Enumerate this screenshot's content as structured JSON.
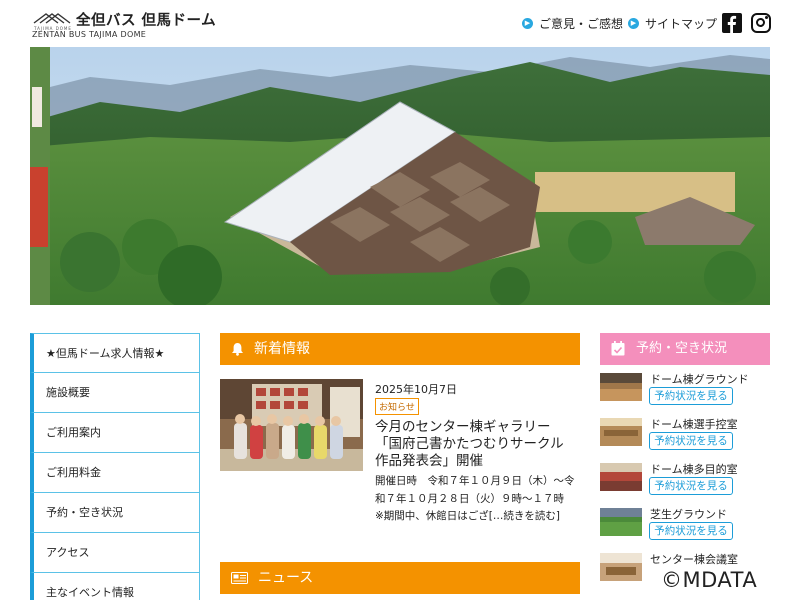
{
  "header": {
    "logo_small": "TAJIMA DOME",
    "logo_jp": "全但バス 但馬ドーム",
    "logo_en": "ZENTAN BUS TAJIMA DOME",
    "links": [
      {
        "label": "ご意見・ご感想"
      },
      {
        "label": "サイトマップ"
      }
    ]
  },
  "sidebar": {
    "items": [
      {
        "label": "★但馬ドーム求人情報★"
      },
      {
        "label": "施設概要"
      },
      {
        "label": "ご利用案内"
      },
      {
        "label": "ご利用料金"
      },
      {
        "label": "予約・空き状況"
      },
      {
        "label": "アクセス"
      },
      {
        "label": "主なイベント情報"
      }
    ]
  },
  "news": {
    "heading": "新着情報",
    "date": "2025年10月7日",
    "tag": "お知らせ",
    "title": "今月のセンター棟ギャラリー「国府己書かたつむりサークル作品発表会」開催",
    "body": "開催日時　令和７年１０月９日（木）～令和７年１０月２８日（火）９時～１７時　　※期間中、休館日はござ[…続きを読む]"
  },
  "news2": {
    "heading": "ニュース"
  },
  "reservation": {
    "heading": "予約・空き状況",
    "button_label": "予約状況を見る",
    "items": [
      {
        "name": "ドーム棟グラウンド"
      },
      {
        "name": "ドーム棟選手控室"
      },
      {
        "name": "ドーム棟多目的室"
      },
      {
        "name": "芝生グラウンド"
      },
      {
        "name": "センター棟会議室"
      }
    ]
  },
  "watermark": "©MDATA",
  "colors": {
    "accent_blue": "#1c9dd8",
    "news_orange": "#f49200",
    "reservation_pink": "#f48fbc"
  }
}
